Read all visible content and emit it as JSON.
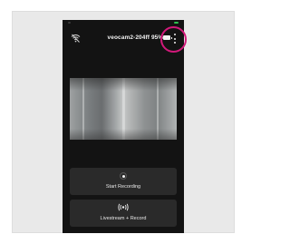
{
  "header": {
    "device_name": "veocam2-204ff",
    "battery_percent": "95%",
    "wifi_icon": "wifi-off-icon",
    "battery_icon": "battery-icon",
    "menu_icon": "more-vertical-icon"
  },
  "preview": {
    "description_icon": "camera-preview"
  },
  "actions": {
    "record": {
      "icon": "record-icon",
      "label": "Start Recording"
    },
    "livestream": {
      "icon": "broadcast-icon",
      "label": "Livestream + Record"
    }
  },
  "colors": {
    "background": "#131313",
    "button": "#2a2a2a",
    "text": "#f2f2f2",
    "highlight": "#d1197a",
    "status_green": "#2fbf4f"
  }
}
